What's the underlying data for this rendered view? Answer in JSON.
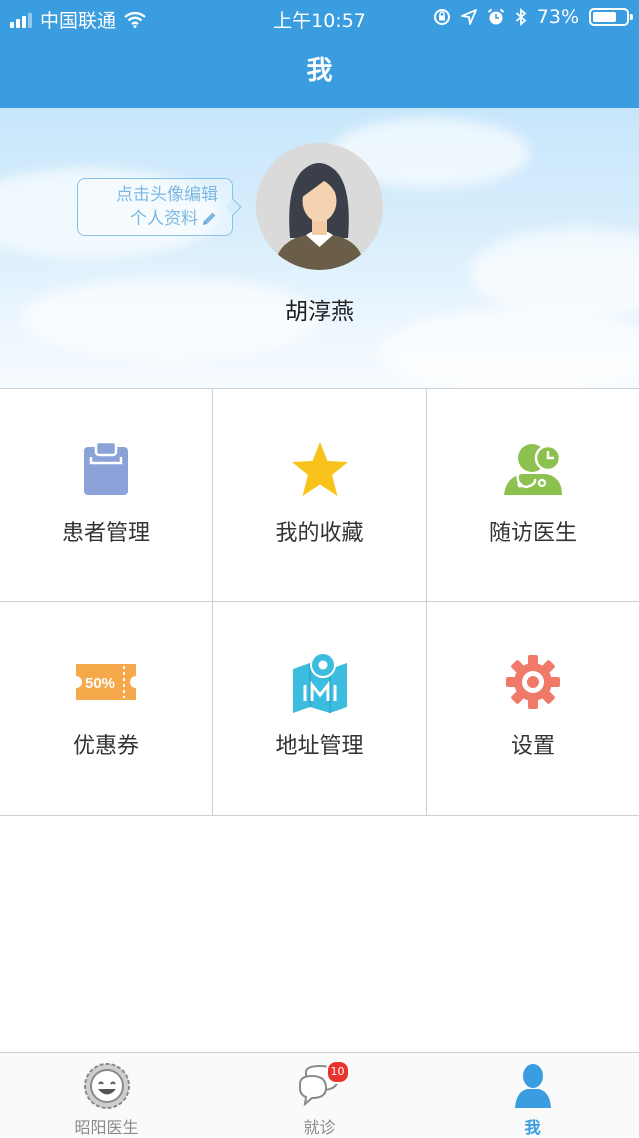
{
  "status_bar": {
    "carrier": "中国联通",
    "time": "上午10:57",
    "battery_percent": "73%",
    "battery_level": 0.73
  },
  "nav": {
    "title": "我"
  },
  "profile": {
    "hint_line1": "点击头像编辑",
    "hint_line2": "个人资料",
    "name": "胡淳燕"
  },
  "menu": [
    {
      "label": "患者管理",
      "icon": "clipboard-icon"
    },
    {
      "label": "我的收藏",
      "icon": "star-icon"
    },
    {
      "label": "随访医生",
      "icon": "doctor-stethoscope-icon"
    },
    {
      "label": "优惠券",
      "icon": "coupon-icon",
      "icon_text": "50%"
    },
    {
      "label": "地址管理",
      "icon": "map-pin-icon"
    },
    {
      "label": "设置",
      "icon": "gear-icon"
    }
  ],
  "tabbar": {
    "tabs": [
      {
        "label": "昭阳医生",
        "icon": "logo-face-icon",
        "active": false
      },
      {
        "label": "就诊",
        "icon": "chat-bubbles-icon",
        "active": false,
        "badge": "10"
      },
      {
        "label": "我",
        "icon": "user-icon",
        "active": true
      }
    ]
  },
  "colors": {
    "nav_bg": "#3a9de0",
    "clipboard": "#8aa2d8",
    "star": "#f7c21a",
    "doctor": "#8cc04f",
    "coupon": "#f5a94a",
    "map": "#3cbde0",
    "gear": "#f07a6a",
    "badge": "#e8342f"
  }
}
